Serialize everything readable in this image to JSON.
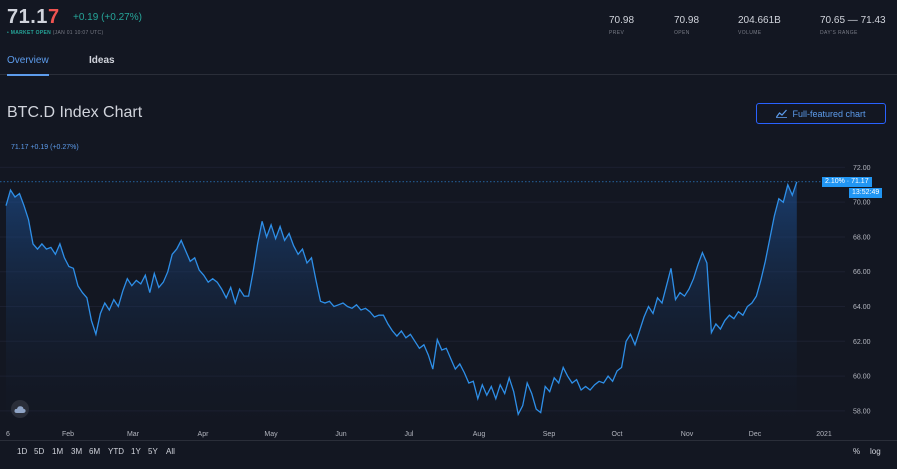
{
  "header": {
    "price_main": "71.1",
    "price_last": "7",
    "change": "+0.19 (+0.27%)",
    "market_dot": "•",
    "market_status": "MARKET OPEN",
    "market_time": "(JAN 01 10:07 UTC)",
    "stats": [
      {
        "value": "70.98",
        "label": "PREV"
      },
      {
        "value": "70.98",
        "label": "OPEN"
      },
      {
        "value": "204.661B",
        "label": "VOLUME"
      },
      {
        "value": "70.65 — 71.43",
        "label": "DAY'S RANGE"
      }
    ]
  },
  "tabs": [
    {
      "label": "Overview",
      "active": true
    },
    {
      "label": "Ideas",
      "active": false
    }
  ],
  "chart_title": "BTC.D Index Chart",
  "full_button": "Full-featured chart",
  "legend": "71.17 +0.19 (+0.27%)",
  "badges": {
    "price": "2.10% · 71.17",
    "time": "13:52:49"
  },
  "range_buttons": [
    "1D",
    "5D",
    "1M",
    "3M",
    "6M",
    "YTD",
    "1Y",
    "5Y",
    "All"
  ],
  "scale_buttons": [
    "%",
    "log"
  ],
  "colors": {
    "accent": "#2196f3",
    "up": "#26a69a",
    "down": "#ef5350",
    "line": "#2e8fe8"
  },
  "chart_data": {
    "type": "area",
    "x_ticks": [
      "6",
      "Feb",
      "Mar",
      "Apr",
      "May",
      "Jun",
      "Jul",
      "Aug",
      "Sep",
      "Oct",
      "Nov",
      "Dec",
      "2021"
    ],
    "y_ticks": [
      72.0,
      70.0,
      68.0,
      66.0,
      64.0,
      62.0,
      60.0,
      58.0
    ],
    "ylim": [
      56.9,
      73.0
    ],
    "x_range": [
      0,
      365
    ],
    "last_value": 71.17,
    "points": [
      [
        0,
        69.8
      ],
      [
        2,
        70.7
      ],
      [
        4,
        70.3
      ],
      [
        6,
        70.5
      ],
      [
        8,
        69.8
      ],
      [
        10,
        69.0
      ],
      [
        12,
        67.6
      ],
      [
        14,
        67.3
      ],
      [
        16,
        67.6
      ],
      [
        18,
        67.3
      ],
      [
        20,
        67.4
      ],
      [
        22,
        67.0
      ],
      [
        24,
        67.6
      ],
      [
        26,
        66.8
      ],
      [
        28,
        66.3
      ],
      [
        30,
        66.2
      ],
      [
        32,
        65.2
      ],
      [
        34,
        64.8
      ],
      [
        36,
        64.5
      ],
      [
        38,
        63.2
      ],
      [
        40,
        62.4
      ],
      [
        42,
        63.6
      ],
      [
        44,
        64.2
      ],
      [
        46,
        63.8
      ],
      [
        48,
        64.4
      ],
      [
        50,
        64.0
      ],
      [
        52,
        64.9
      ],
      [
        54,
        65.6
      ],
      [
        56,
        65.2
      ],
      [
        58,
        65.5
      ],
      [
        60,
        65.3
      ],
      [
        62,
        65.8
      ],
      [
        64,
        64.8
      ],
      [
        66,
        65.9
      ],
      [
        68,
        65.1
      ],
      [
        70,
        65.4
      ],
      [
        72,
        66.0
      ],
      [
        74,
        67.0
      ],
      [
        76,
        67.3
      ],
      [
        78,
        67.8
      ],
      [
        80,
        67.2
      ],
      [
        82,
        66.6
      ],
      [
        84,
        66.8
      ],
      [
        86,
        66.1
      ],
      [
        88,
        65.8
      ],
      [
        90,
        65.4
      ],
      [
        92,
        65.6
      ],
      [
        94,
        65.4
      ],
      [
        96,
        65.0
      ],
      [
        98,
        64.5
      ],
      [
        100,
        65.1
      ],
      [
        102,
        64.2
      ],
      [
        104,
        65.0
      ],
      [
        106,
        64.6
      ],
      [
        108,
        64.6
      ],
      [
        110,
        66.0
      ],
      [
        112,
        67.6
      ],
      [
        114,
        68.9
      ],
      [
        116,
        68.0
      ],
      [
        118,
        68.7
      ],
      [
        120,
        67.9
      ],
      [
        122,
        68.6
      ],
      [
        124,
        67.8
      ],
      [
        126,
        68.2
      ],
      [
        128,
        67.5
      ],
      [
        130,
        67.0
      ],
      [
        132,
        67.3
      ],
      [
        134,
        66.5
      ],
      [
        136,
        66.8
      ],
      [
        138,
        65.5
      ],
      [
        140,
        64.3
      ],
      [
        142,
        64.2
      ],
      [
        144,
        64.3
      ],
      [
        146,
        64.0
      ],
      [
        148,
        64.1
      ],
      [
        150,
        64.2
      ],
      [
        152,
        64.0
      ],
      [
        154,
        63.9
      ],
      [
        156,
        64.1
      ],
      [
        158,
        63.8
      ],
      [
        160,
        63.9
      ],
      [
        162,
        63.7
      ],
      [
        164,
        63.4
      ],
      [
        166,
        63.5
      ],
      [
        168,
        63.5
      ],
      [
        170,
        63.0
      ],
      [
        172,
        62.6
      ],
      [
        174,
        62.3
      ],
      [
        176,
        62.6
      ],
      [
        178,
        62.2
      ],
      [
        180,
        62.4
      ],
      [
        182,
        62.0
      ],
      [
        184,
        61.6
      ],
      [
        186,
        61.8
      ],
      [
        188,
        61.2
      ],
      [
        190,
        60.4
      ],
      [
        192,
        62.1
      ],
      [
        194,
        61.5
      ],
      [
        196,
        61.6
      ],
      [
        198,
        61.0
      ],
      [
        200,
        60.4
      ],
      [
        202,
        60.7
      ],
      [
        204,
        60.2
      ],
      [
        206,
        59.6
      ],
      [
        208,
        59.7
      ],
      [
        210,
        58.7
      ],
      [
        212,
        59.5
      ],
      [
        214,
        58.9
      ],
      [
        216,
        59.4
      ],
      [
        218,
        58.7
      ],
      [
        220,
        59.5
      ],
      [
        222,
        59.0
      ],
      [
        224,
        59.9
      ],
      [
        226,
        59.1
      ],
      [
        228,
        57.8
      ],
      [
        230,
        58.3
      ],
      [
        232,
        59.6
      ],
      [
        234,
        59.0
      ],
      [
        236,
        58.1
      ],
      [
        238,
        57.9
      ],
      [
        240,
        59.4
      ],
      [
        242,
        59.1
      ],
      [
        244,
        59.9
      ],
      [
        246,
        59.6
      ],
      [
        248,
        60.5
      ],
      [
        250,
        60.0
      ],
      [
        252,
        59.6
      ],
      [
        254,
        59.8
      ],
      [
        256,
        59.2
      ],
      [
        258,
        59.4
      ],
      [
        260,
        59.2
      ],
      [
        262,
        59.5
      ],
      [
        264,
        59.7
      ],
      [
        266,
        59.6
      ],
      [
        268,
        60.0
      ],
      [
        270,
        59.7
      ],
      [
        272,
        60.3
      ],
      [
        274,
        60.5
      ],
      [
        276,
        62.0
      ],
      [
        278,
        62.4
      ],
      [
        280,
        61.8
      ],
      [
        282,
        62.6
      ],
      [
        284,
        63.4
      ],
      [
        286,
        64.0
      ],
      [
        288,
        63.6
      ],
      [
        290,
        64.5
      ],
      [
        292,
        64.2
      ],
      [
        294,
        65.2
      ],
      [
        296,
        66.2
      ],
      [
        298,
        64.4
      ],
      [
        300,
        64.8
      ],
      [
        302,
        64.6
      ],
      [
        304,
        65.0
      ],
      [
        306,
        65.6
      ],
      [
        308,
        66.4
      ],
      [
        310,
        67.1
      ],
      [
        312,
        66.5
      ],
      [
        314,
        62.5
      ],
      [
        316,
        63.0
      ],
      [
        318,
        62.7
      ],
      [
        320,
        63.2
      ],
      [
        322,
        63.5
      ],
      [
        324,
        63.3
      ],
      [
        326,
        63.7
      ],
      [
        328,
        63.5
      ],
      [
        330,
        64.0
      ],
      [
        332,
        64.2
      ],
      [
        334,
        64.6
      ],
      [
        336,
        65.5
      ],
      [
        338,
        66.6
      ],
      [
        340,
        67.9
      ],
      [
        342,
        69.2
      ],
      [
        344,
        70.2
      ],
      [
        346,
        70.0
      ],
      [
        348,
        71.0
      ],
      [
        350,
        70.4
      ],
      [
        352,
        71.17
      ]
    ]
  }
}
